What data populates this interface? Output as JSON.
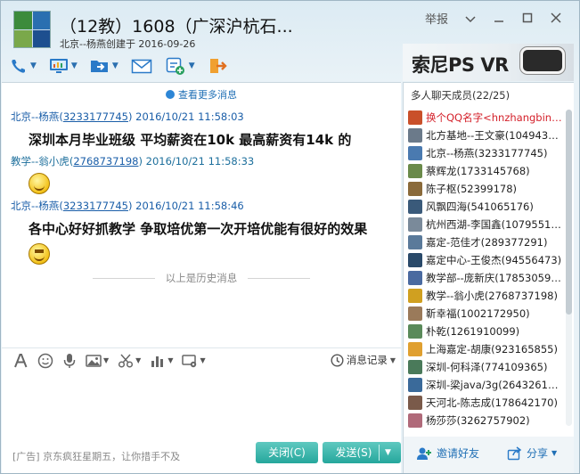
{
  "window": {
    "title": "（12教）1608（广深沪杭石...",
    "subtitle": "北京--杨燕创建于 2016-09-26",
    "report_label": "举报",
    "controls": [
      "chevron-down",
      "minimize",
      "maximize",
      "close"
    ]
  },
  "toolbar": {
    "items": [
      "phone-icon",
      "screen-share-icon",
      "file-transfer-icon",
      "mail-icon",
      "add-app-icon",
      "exit-icon"
    ]
  },
  "ad_banner": {
    "text": "索尼PS VR"
  },
  "chat": {
    "more_messages": "查看更多消息",
    "messages": [
      {
        "sender": "北京--杨燕",
        "qq": "3233177745",
        "time": "2016/10/21 11:58:03",
        "text": "深圳本月毕业班级 平均薪资在10k 最高薪资有14k 的"
      },
      {
        "sender": "教学--翁小虎",
        "qq": "2768737198",
        "time": "2016/10/21 11:58:33",
        "text": ""
      },
      {
        "sender": "北京--杨燕",
        "qq": "3233177745",
        "time": "2016/10/21 11:58:46",
        "text": "各中心好好抓教学 争取培优第一次开培优能有很好的效果"
      }
    ],
    "history_divider": "以上是历史消息"
  },
  "input_toolbar": {
    "history_label": "消息记录"
  },
  "bottom": {
    "ad": "[广告] 京东疯狂星期五，让你措手不及",
    "close_label": "关闭(C)",
    "send_label": "发送(S)"
  },
  "members": {
    "title": "多人聊天成员(22/25)",
    "items": [
      {
        "name": "换个QQ名字<hnzhangbin@1...",
        "highlight": true,
        "color": "#c9502a"
      },
      {
        "name": "北方基地--王文豪(10494308...",
        "highlight": false,
        "color": "#6b7a8a"
      },
      {
        "name": "北京--杨燕(3233177745)",
        "highlight": false,
        "color": "#4a7ab0"
      },
      {
        "name": "蔡辉龙(1733145768)",
        "highlight": false,
        "color": "#6a8a4a"
      },
      {
        "name": "陈子枢(52399178)",
        "highlight": false,
        "color": "#8a6a3a"
      },
      {
        "name": "风飘四海(541065176)",
        "highlight": false,
        "color": "#3a5a7a"
      },
      {
        "name": "杭州西湖-李国鑫(1079551947)",
        "highlight": false,
        "color": "#7a8a9a"
      },
      {
        "name": "嘉定-范佳才(289377291)",
        "highlight": false,
        "color": "#5a7a9a"
      },
      {
        "name": "嘉定中心-王俊杰(94556473)",
        "highlight": false,
        "color": "#2a4a6a"
      },
      {
        "name": "教学部--庞新庆(1785305913)",
        "highlight": false,
        "color": "#4a6aa0"
      },
      {
        "name": "教学--翁小虎(2768737198)",
        "highlight": false,
        "color": "#d0a020"
      },
      {
        "name": "靳幸福(1002172950)",
        "highlight": false,
        "color": "#9a7a5a"
      },
      {
        "name": "朴乾(1261910099)",
        "highlight": false,
        "color": "#5a8a5a"
      },
      {
        "name": "上海嘉定-胡康(923165855)",
        "highlight": false,
        "color": "#e0a030"
      },
      {
        "name": "深圳-何科泽(774109365)",
        "highlight": false,
        "color": "#4a7a5a"
      },
      {
        "name": "深圳-梁java/3g(2643261519)",
        "highlight": false,
        "color": "#3a6a9a"
      },
      {
        "name": "天河北-陈志成(178642170)",
        "highlight": false,
        "color": "#7a5a4a"
      },
      {
        "name": "杨莎莎(3262757902)",
        "highlight": false,
        "color": "#b06a7a"
      }
    ],
    "invite_label": "邀请好友",
    "share_label": "分享"
  }
}
